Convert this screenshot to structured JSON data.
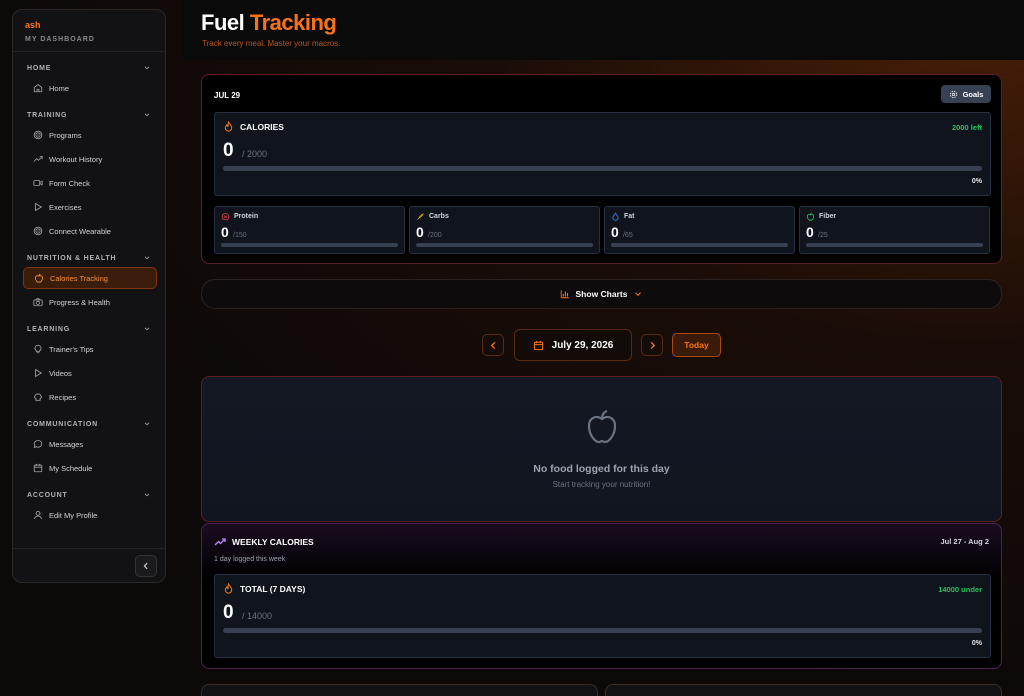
{
  "sidebar": {
    "user_name": "ash",
    "subtitle": "MY DASHBOARD",
    "sections": [
      {
        "label": "HOME",
        "items": [
          {
            "label": "Home",
            "icon": "home-icon"
          }
        ]
      },
      {
        "label": "TRAINING",
        "items": [
          {
            "label": "Programs",
            "icon": "target-icon"
          },
          {
            "label": "Workout History",
            "icon": "trending-icon"
          },
          {
            "label": "Form Check",
            "icon": "video-icon"
          },
          {
            "label": "Exercises",
            "icon": "play-icon"
          },
          {
            "label": "Connect Wearable",
            "icon": "target-icon"
          }
        ]
      },
      {
        "label": "NUTRITION & HEALTH",
        "items": [
          {
            "label": "Calories Tracking",
            "icon": "apple-icon",
            "active": true
          },
          {
            "label": "Progress & Health",
            "icon": "camera-icon"
          }
        ]
      },
      {
        "label": "LEARNING",
        "items": [
          {
            "label": "Trainer's Tips",
            "icon": "lightbulb-icon"
          },
          {
            "label": "Videos",
            "icon": "play-icon"
          },
          {
            "label": "Recipes",
            "icon": "chef-hat-icon"
          }
        ]
      },
      {
        "label": "COMMUNICATION",
        "items": [
          {
            "label": "Messages",
            "icon": "message-icon"
          },
          {
            "label": "My Schedule",
            "icon": "calendar-icon"
          }
        ]
      },
      {
        "label": "ACCOUNT",
        "items": [
          {
            "label": "Edit My Profile",
            "icon": "user-icon"
          }
        ]
      }
    ]
  },
  "header": {
    "title_part1": "Fuel",
    "title_part2": "Tracking",
    "tagline": "Track every meal. Master your macros."
  },
  "today": {
    "date_label": "JUL 29",
    "goals_label": "Goals",
    "calories": {
      "label": "CALORIES",
      "value": "0",
      "goal": "/ 2000",
      "remaining": "2000 left",
      "percent": "0%",
      "fraction": 0
    },
    "macros": [
      {
        "label": "Protein",
        "value": "0",
        "goal": "/150",
        "fraction": 0,
        "color": "#ef4444",
        "icon": "protein-icon"
      },
      {
        "label": "Carbs",
        "value": "0",
        "goal": "/200",
        "fraction": 0,
        "color": "#eab308",
        "icon": "wheat-icon"
      },
      {
        "label": "Fat",
        "value": "0",
        "goal": "/65",
        "fraction": 0,
        "color": "#3b82f6",
        "icon": "droplet-icon"
      },
      {
        "label": "Fiber",
        "value": "0",
        "goal": "/25",
        "fraction": 0,
        "color": "#22c55e",
        "icon": "fiber-apple-icon"
      }
    ]
  },
  "charts_toggle": {
    "label": "Show Charts"
  },
  "date_nav": {
    "date": "July 29, 2026",
    "today_label": "Today"
  },
  "empty_state": {
    "title": "No food logged for this day",
    "subtitle": "Start tracking your nutrition!"
  },
  "weekly": {
    "title": "WEEKLY CALORIES",
    "range": "Jul 27 - Aug 2",
    "subtitle": "1 day logged this week",
    "total": {
      "label": "TOTAL (7 DAYS)",
      "value": "0",
      "goal": "/ 14000",
      "status": "14000 under",
      "percent": "0%",
      "fraction": 0
    }
  },
  "colors": {
    "accent": "#f97316",
    "success": "#22c55e"
  }
}
